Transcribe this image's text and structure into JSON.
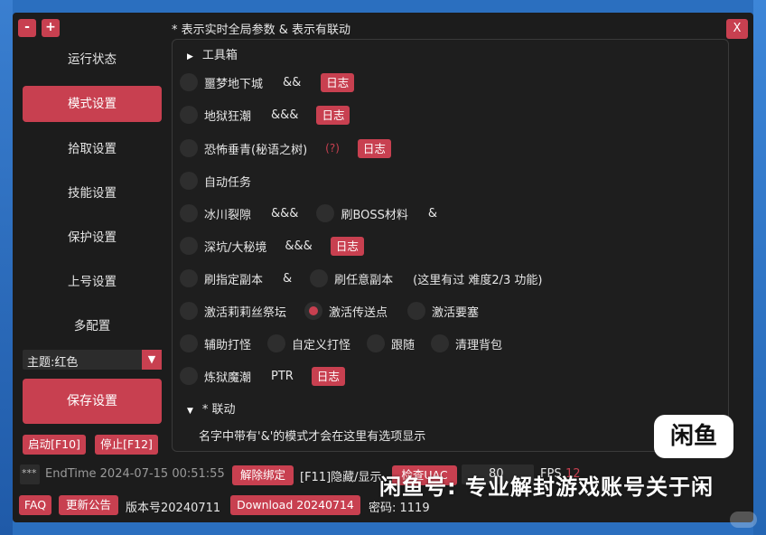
{
  "window": {
    "minimize_label": "-",
    "maximize_label": "+",
    "close_label": "X",
    "header": "* 表示实时全局参数 & 表示有联动"
  },
  "sidebar": {
    "items": [
      {
        "label": "运行状态",
        "active": false
      },
      {
        "label": "模式设置",
        "active": true
      },
      {
        "label": "拾取设置",
        "active": false
      },
      {
        "label": "技能设置",
        "active": false
      },
      {
        "label": "保护设置",
        "active": false
      },
      {
        "label": "上号设置",
        "active": false
      },
      {
        "label": "多配置",
        "active": false
      }
    ],
    "theme_label": "主题:红色",
    "save_label": "保存设置",
    "start_label": "启动[F10]",
    "stop_label": "停止[F12]"
  },
  "panel": {
    "toolbox_label": "工具箱",
    "rows": {
      "r1": {
        "name": "噩梦地下城",
        "amp": "&&",
        "log": "日志"
      },
      "r2": {
        "name": "地狱狂潮",
        "amp": "&&&",
        "log": "日志"
      },
      "r3": {
        "name": "恐怖垂青(秘语之树)",
        "hint": "(?)",
        "log": "日志"
      },
      "r4": {
        "name": "自动任务"
      },
      "r5": {
        "name": "冰川裂隙",
        "amp": "&&&",
        "name2": "刷BOSS材料",
        "amp2": "&"
      },
      "r6": {
        "name": "深坑/大秘境",
        "amp": "&&&",
        "log": "日志"
      },
      "r7": {
        "name": "刷指定副本",
        "amp": "&",
        "name2": "刷任意副本",
        "note": "(这里有过 难度2/3 功能)"
      },
      "r8": {
        "name": "激活莉莉丝祭坛",
        "name2": "激活传送点",
        "name3": "激活要塞"
      },
      "r9": {
        "name": "辅助打怪",
        "name2": "自定义打怪",
        "name3": "跟随",
        "name4": "清理背包"
      },
      "r10": {
        "name": "炼狱魔潮",
        "extra": "PTR",
        "log": "日志"
      }
    },
    "linkage_label": "* 联动",
    "linkage_hint": "名字中带有'&'的模式才会在这里有选项显示"
  },
  "statusbar": {
    "dots": "***",
    "endtime": "EndTime 2024-07-15 00:51:55",
    "unbind_label": "解除绑定",
    "hide_label": "[F11]隐藏/显示",
    "check_label": "检查UAC",
    "fps_value": "80",
    "fps_label": "FPS",
    "fps_num": "12"
  },
  "footer": {
    "faq_label": "FAQ",
    "notice_label": "更新公告",
    "version": "版本号20240711",
    "download_label": "Download 20240714",
    "password": "密码: 1119"
  },
  "watermark": {
    "logo": "闲鱼",
    "text": "闲鱼号: 专业解封游戏账号关于闲"
  }
}
